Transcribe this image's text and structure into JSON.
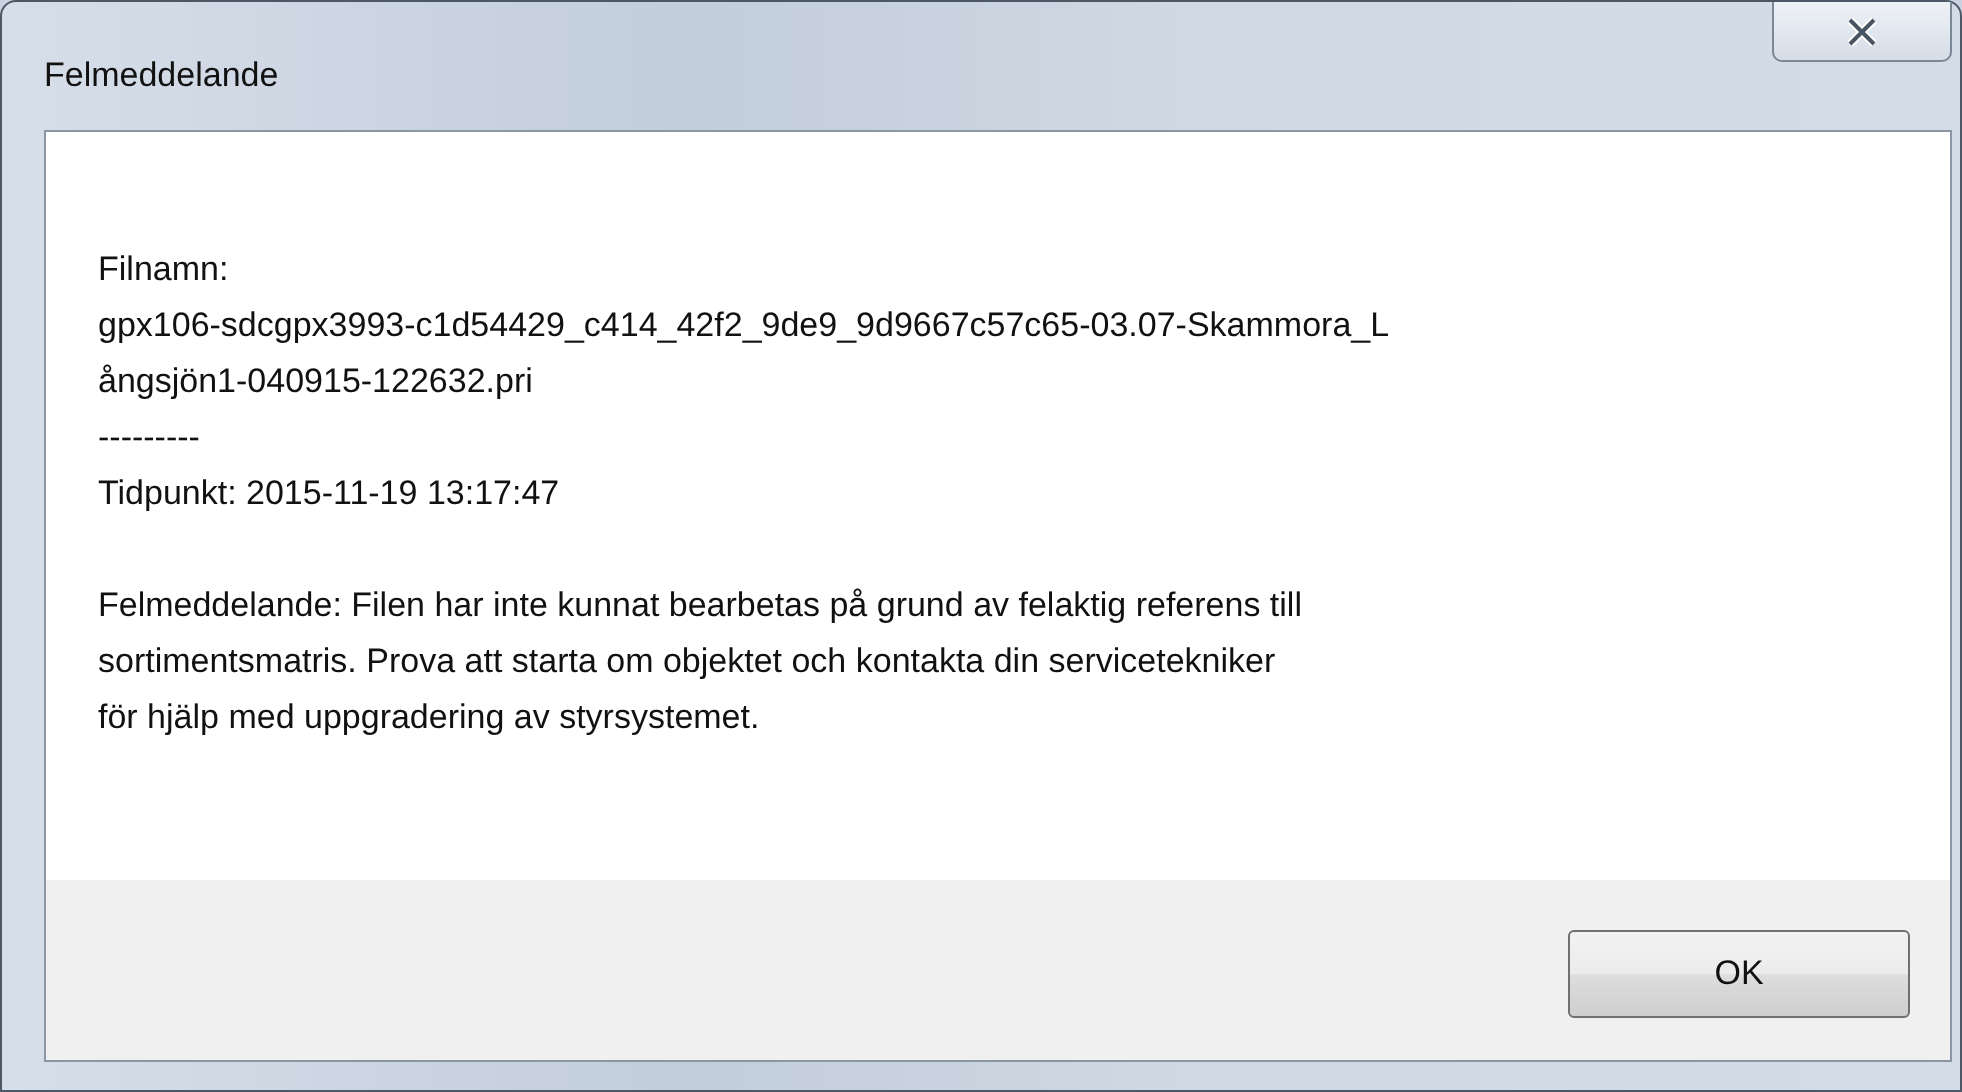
{
  "window": {
    "title": "Felmeddelande"
  },
  "message": [
    {
      "lines": [
        "Filnamn:",
        "gpx106-sdcgpx3993-c1d54429_c414_42f2_9de9_9d9667c57c65-03.07-Skammora_L",
        "ångsjön1-040915-122632.pri",
        "---------",
        "Tidpunkt: 2015-11-19 13:17:47"
      ]
    },
    {
      "lines": [
        "Felmeddelande: Filen har inte kunnat bearbetas på grund av felaktig referens till",
        "sortimentsmatris. Prova att starta om objektet och kontakta din servicetekniker",
        "för hjälp med uppgradering av styrsystemet."
      ]
    }
  ],
  "buttons": [
    "OK"
  ]
}
